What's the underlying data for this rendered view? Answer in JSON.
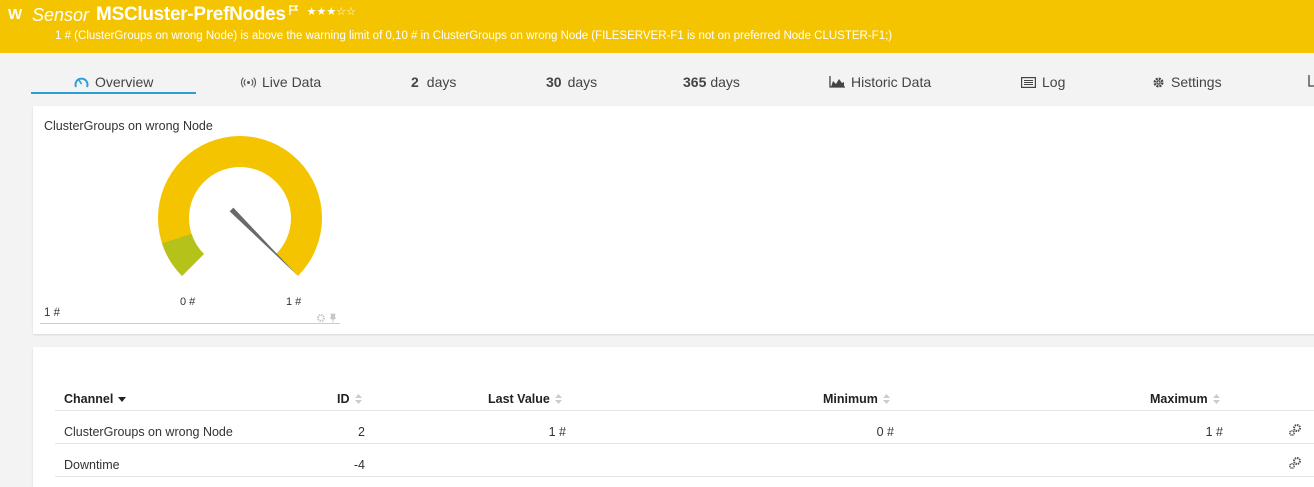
{
  "header": {
    "status_letter": "W",
    "sensor_type": "Sensor",
    "sensor_name": "MSCluster-PrefNodes",
    "priority_stars": "★★★☆☆",
    "message": "1 # (ClusterGroups on wrong Node) is above the warning limit of 0,10 # in ClusterGroups on wrong Node (FILESERVER-F1 is not on preferred Node CLUSTER-F1;)",
    "color": "#f5c400"
  },
  "tabs": [
    {
      "label": "Overview",
      "icon": "gauge-icon",
      "active": true
    },
    {
      "label": "Live Data",
      "icon": "live-signal-icon"
    },
    {
      "num": "2",
      "label": "days"
    },
    {
      "num": "30",
      "label": "days"
    },
    {
      "num": "365",
      "label": "days"
    },
    {
      "label": "Historic Data",
      "icon": "area-chart-icon"
    },
    {
      "label": "Log",
      "icon": "log-list-icon"
    },
    {
      "label": "Settings",
      "icon": "gear-icon"
    }
  ],
  "gauge": {
    "title": "ClusterGroups on wrong Node",
    "min_label": "0 #",
    "max_label": "1 #",
    "value_label": "1 #",
    "value_fraction": 1.0,
    "colors": {
      "track": "#f5c400",
      "ok_zone": "#b5c219",
      "needle": "#6a6a6a"
    }
  },
  "table": {
    "columns": [
      {
        "label": "Channel",
        "sort": "desc-active"
      },
      {
        "label": "ID",
        "sort": "both"
      },
      {
        "label": "Last Value",
        "sort": "both"
      },
      {
        "label": "Minimum",
        "sort": "both"
      },
      {
        "label": "Maximum",
        "sort": "both"
      }
    ],
    "rows": [
      {
        "channel": "ClusterGroups on wrong Node",
        "id": "2",
        "last": "1 #",
        "min": "0 #",
        "max": "1 #"
      },
      {
        "channel": "Downtime",
        "id": "-4",
        "last": "",
        "min": "",
        "max": ""
      }
    ]
  }
}
